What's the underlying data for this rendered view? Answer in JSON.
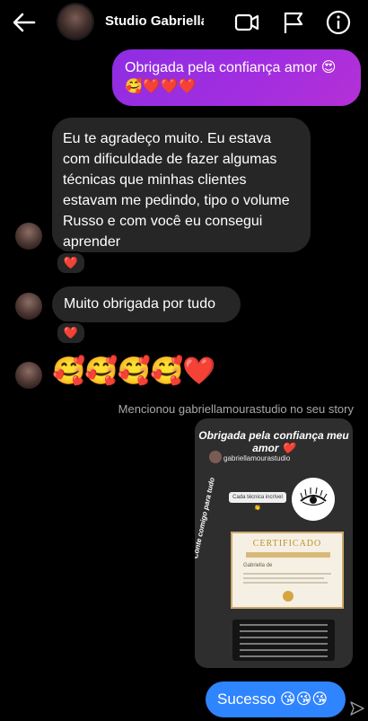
{
  "header": {
    "name": "Studio Gabriellæ",
    "back_icon": "arrow-left-icon",
    "icons": [
      "video-call-icon",
      "flag-icon",
      "info-icon"
    ]
  },
  "messages": {
    "sent_1": "Obrigada pela confiança amor 😍🥰❤️❤️❤️",
    "received_1": "Eu te agradeço muito. Eu estava com dificuldade de fazer algumas técnicas que minhas clientes estavam me pedindo, tipo o volume Russo e com você eu consegui aprender",
    "received_1_reaction": "❤️",
    "received_2": "Muito obrigada por tudo",
    "received_2_reaction": "❤️",
    "received_3": "🥰🥰🥰🥰❤️",
    "mention_note": "Mencionou gabriellamourastudio no seu story",
    "sent_2": "Sucesso 😘😘😘"
  },
  "story": {
    "title": "Obrigada pela confiança meu amor ❤️",
    "username": "gabriellamourastudio",
    "chip": "Cada técnica incrível 👏",
    "side_text": "Conte comigo para tudo",
    "cert_title": "CERTIFICADO",
    "cert_name": "Gabriella de"
  },
  "colors": {
    "sent_bubble": "#a12ee0",
    "received_bubble": "#262626",
    "sent_blue": "#2f84ff",
    "background": "#000000"
  }
}
